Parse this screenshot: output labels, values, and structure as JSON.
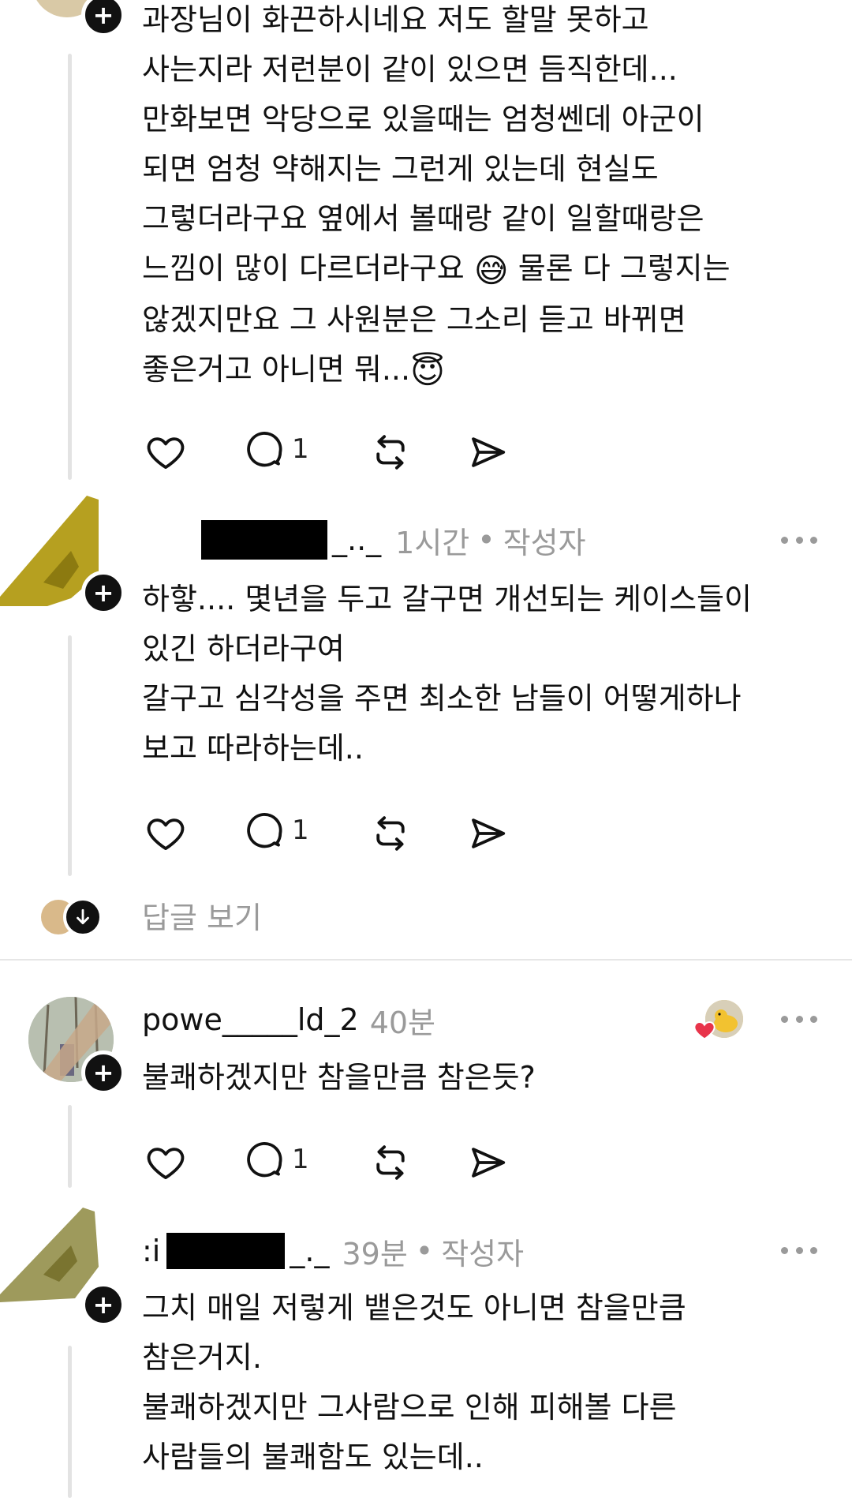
{
  "comment1": {
    "lines": [
      "과장님이 화끈하시네요 저도 할말 못하고",
      "사는지라 저런분이 같이 있으면 듬직한데...",
      "만화보면 악당으로 있을때는 엄청쎈데 아군이",
      "되면 엄청 약해지는 그런게 있는데 현실도",
      "그렇더라구요 옆에서 볼때랑 같이 일할때랑은",
      "느낌이 많이 다르더라구요",
      "물론 다 그렇지는",
      "않겠지만요 그 사원분은 그소리 듣고 바뀌면",
      "좋은거고 아니면 뭐..."
    ],
    "emoji_sweat": "😅",
    "emoji_halo": "😇",
    "reply_count": "1"
  },
  "comment2": {
    "username_visible": "_.._",
    "time": "1시간",
    "author_badge": "작성자",
    "separator": "•",
    "lines": [
      "하핳.... 몇년을 두고 갈구면 개선되는 케이스들이",
      "있긴 하더라구여",
      "갈구고 심각성을 주면 최소한 남들이 어떻게하나",
      "보고 따라하는데.."
    ],
    "reply_count": "1"
  },
  "view_replies": {
    "label": "답글 보기"
  },
  "comment3": {
    "username": "powe_____ld_2",
    "time": "40분",
    "lines": [
      "불쾌하겠지만 참을만큼 참은듯?"
    ],
    "reply_count": "1"
  },
  "comment4": {
    "username_visible": "_._",
    "time": "39분",
    "author_badge": "작성자",
    "separator": "•",
    "lines": [
      "그치 매일 저렇게 뱉은것도 아니면 참을만큼",
      "참은거지.",
      "불쾌하겠지만 그사람으로 인해 피해볼 다른",
      "사람들의 불쾌함도 있는데.."
    ]
  },
  "icons": {
    "like": "heart-icon",
    "reply": "comment-bubble-icon",
    "repost": "repost-icon",
    "share": "send-icon",
    "more": "more-dots-icon",
    "follow": "plus-icon",
    "expand": "arrow-down-icon"
  },
  "colors": {
    "text": "#111111",
    "meta": "#9a9a9a",
    "thread_line": "#e3e3e3",
    "liked_heart": "#e8344a"
  }
}
